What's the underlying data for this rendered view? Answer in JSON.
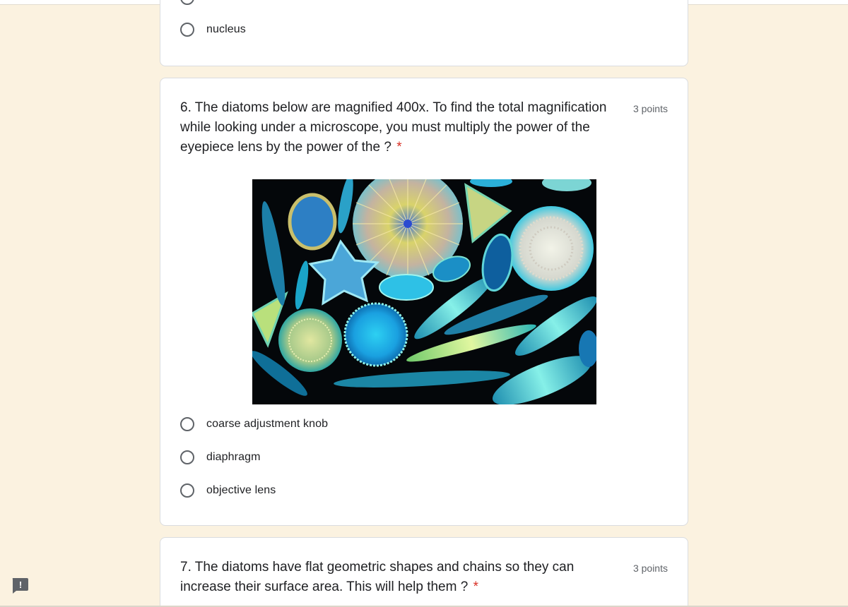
{
  "previous_question": {
    "options": [
      {
        "label": "nucleus"
      }
    ]
  },
  "question6": {
    "title": "6. The diatoms below are magnified 400x. To find the total magnification while looking under a microscope, you must multiply the power of the eyepiece lens by the power of the ?",
    "required_mark": "*",
    "points": "3 points",
    "options": [
      {
        "label": "coarse adjustment knob"
      },
      {
        "label": "diaphragm"
      },
      {
        "label": "objective lens"
      }
    ]
  },
  "question7": {
    "title": "7. The diatoms have flat geometric shapes and chains so they can increase their surface area. This will help them ?",
    "required_mark": "*",
    "points": "3 points"
  },
  "feedback": {
    "glyph": "!"
  },
  "colors": {
    "page_background": "#fbf2e0",
    "card_background": "#ffffff",
    "required": "#d93025",
    "feedback_icon": "#5f6368"
  },
  "icons": [
    "radio-unchecked-icon",
    "report-problem-icon"
  ]
}
